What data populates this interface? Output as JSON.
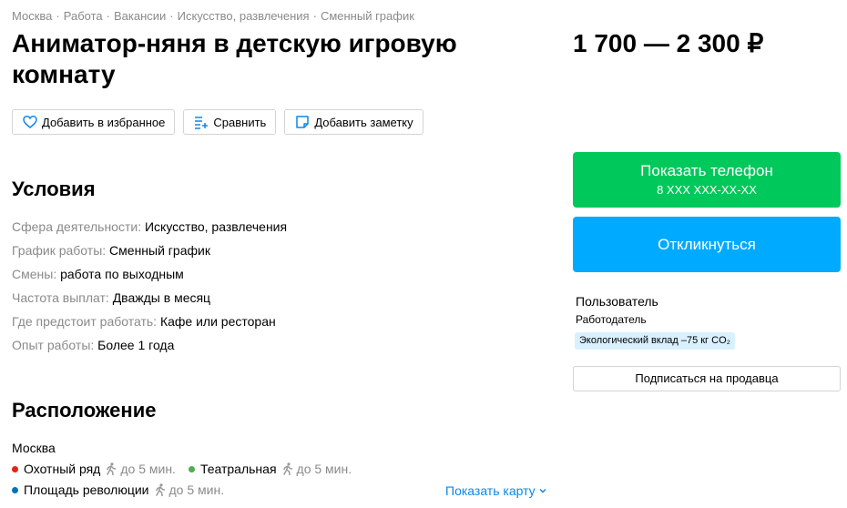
{
  "breadcrumbs": [
    "Москва",
    "Работа",
    "Вакансии",
    "Искусство, развлечения",
    "Сменный график"
  ],
  "title": "Аниматор-няня в детскую игровую комнату",
  "price": "1 700 — 2 300 ₽",
  "actions": {
    "favorite_label": "Добавить в избранное",
    "compare_label": "Сравнить",
    "note_label": "Добавить заметку"
  },
  "conditions": {
    "heading": "Условия",
    "params": [
      {
        "label": "Сфера деятельности:",
        "value": "Искусство, развлечения"
      },
      {
        "label": "График работы:",
        "value": "Сменный график"
      },
      {
        "label": "Смены:",
        "value": "работа по выходным"
      },
      {
        "label": "Частота выплат:",
        "value": "Дважды в месяц"
      },
      {
        "label": "Где предстоит работать:",
        "value": "Кафе или ресторан"
      },
      {
        "label": "Опыт работы:",
        "value": "Более 1 года"
      }
    ]
  },
  "location": {
    "heading": "Расположение",
    "city": "Москва",
    "stations": [
      {
        "name": "Охотный ряд",
        "time": "до 5 мин.",
        "color": "#e42313"
      },
      {
        "name": "Театральная",
        "time": "до 5 мин.",
        "color": "#4baf4f"
      },
      {
        "name": "Площадь революции",
        "time": "до 5 мин.",
        "color": "#0072ba"
      }
    ],
    "show_map_label": "Показать карту"
  },
  "sidebar": {
    "phone_button_label": "Показать телефон",
    "phone_masked": "8 XXX XXX-XX-XX",
    "respond_button_label": "Откликнуться",
    "seller_name": "Пользователь",
    "seller_role": "Работодатель",
    "eco_badge": "Экологический вклад –75 кг CO₂",
    "subscribe_label": "Подписаться на продавца"
  },
  "colors": {
    "phone_button": "#00c85a",
    "respond_button": "#00aaff",
    "link": "#0a88e8",
    "muted_text": "#8a8a8a",
    "eco_badge_bg": "#d9f0ff"
  }
}
